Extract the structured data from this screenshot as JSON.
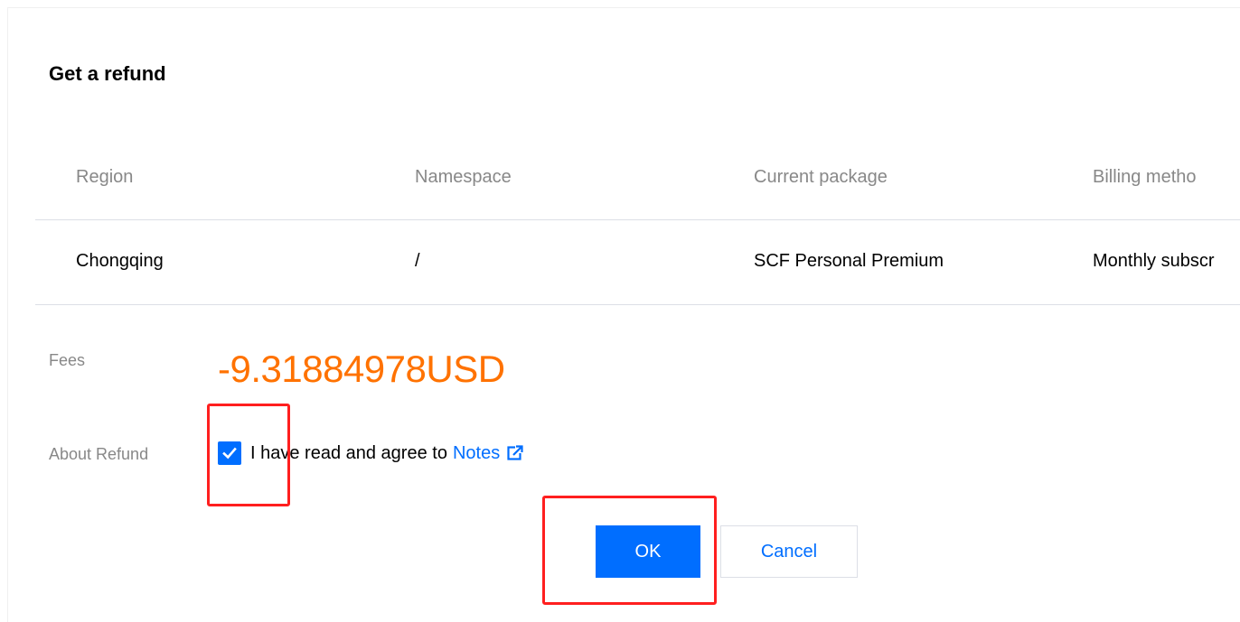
{
  "dialog": {
    "title": "Get a refund"
  },
  "table": {
    "headers": [
      "Region",
      "Namespace",
      "Current package",
      "Billing metho"
    ],
    "rows": [
      [
        "Chongqing",
        "/",
        "SCF Personal Premium",
        "Monthly subscr"
      ]
    ]
  },
  "fees": {
    "label": "Fees",
    "value": "-9.31884978USD"
  },
  "refund": {
    "label": "About Refund",
    "agree_text": "I have read and agree to",
    "notes_link": "Notes",
    "checked": true
  },
  "buttons": {
    "ok_label": "OK",
    "cancel_label": "Cancel"
  },
  "colors": {
    "accent": "#006eff",
    "fees": "#ff7200",
    "highlight": "#ff1f1f"
  },
  "icons": {
    "checkbox": "checkmark-icon",
    "notes": "external-link-icon"
  }
}
